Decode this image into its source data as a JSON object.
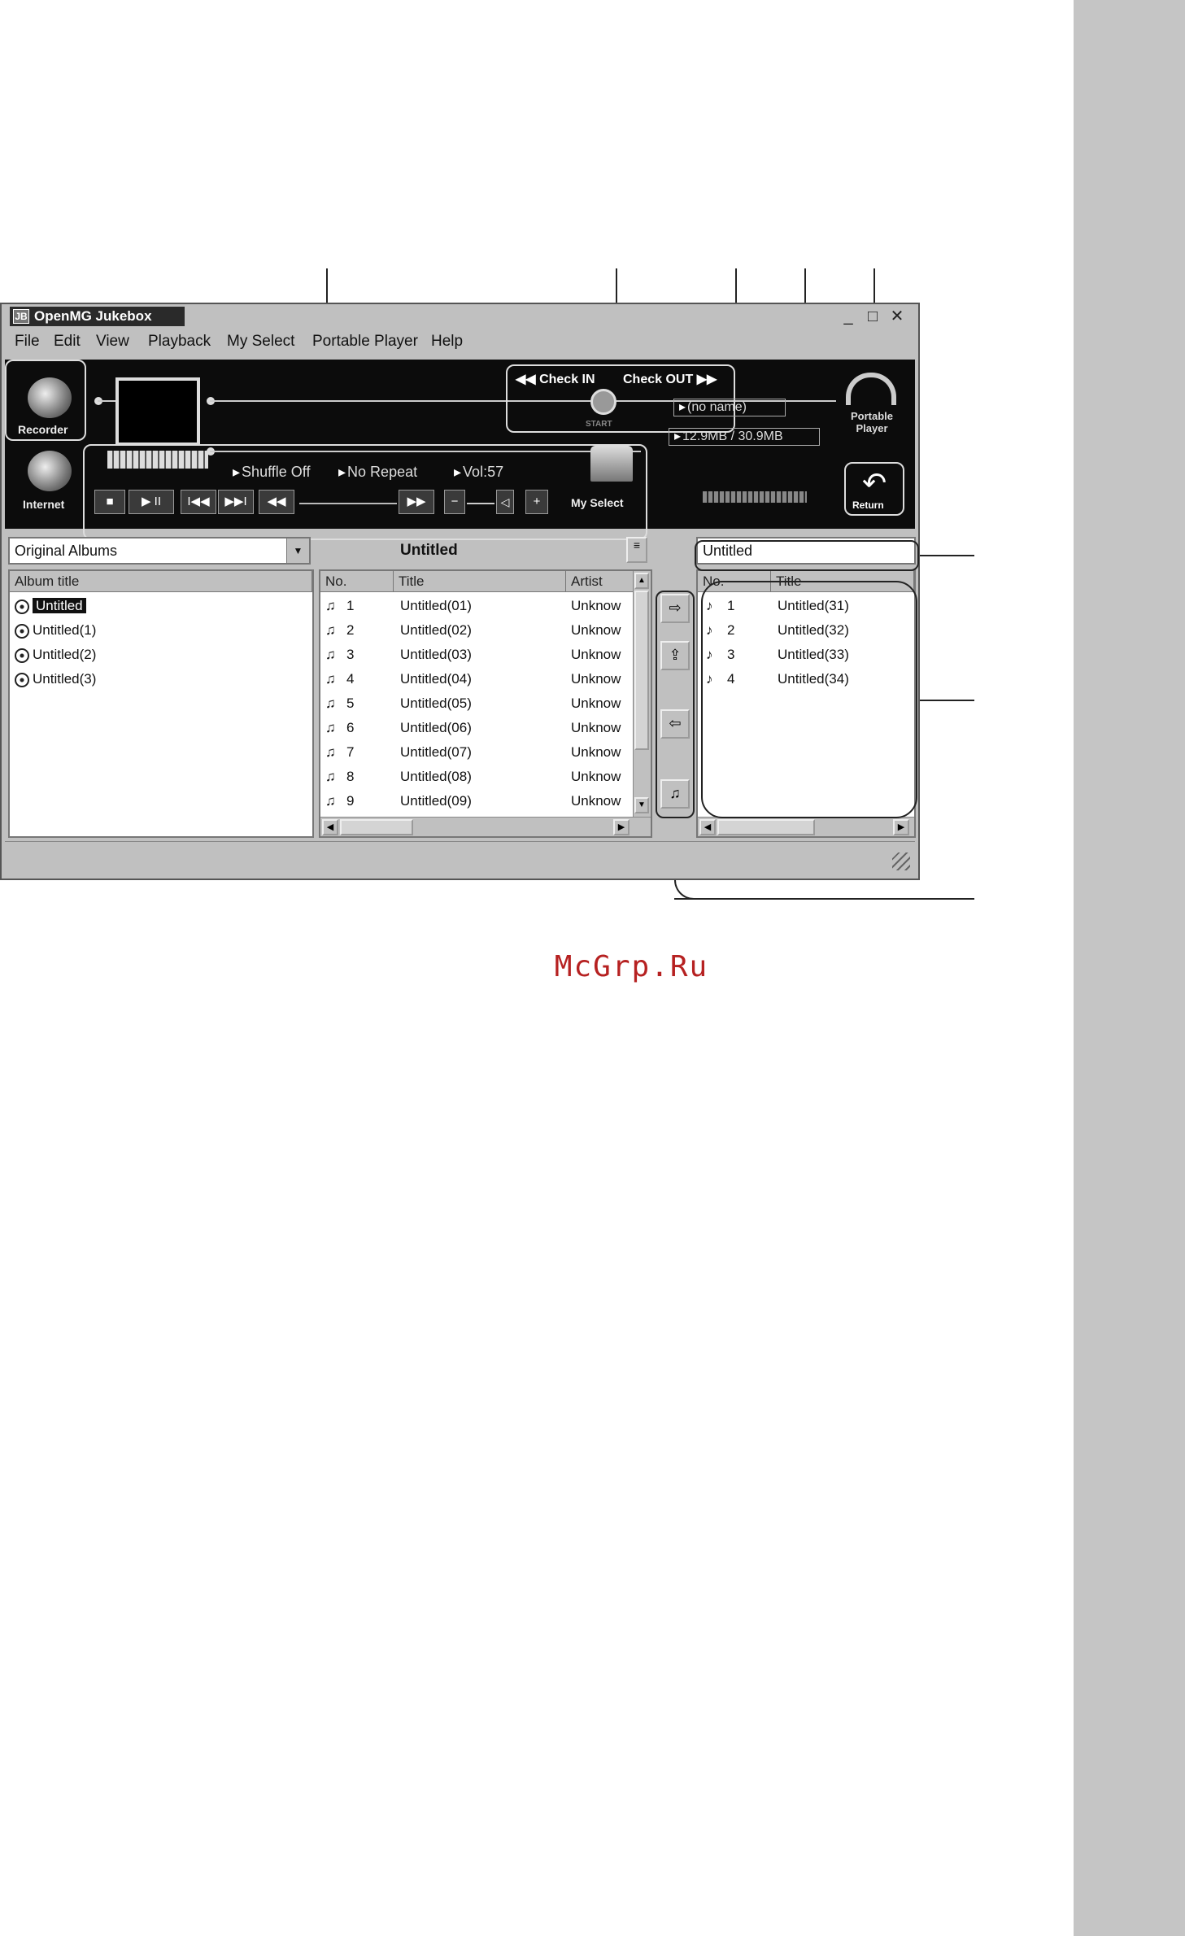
{
  "window": {
    "title": "OpenMG Jukebox",
    "icon_label": "JB",
    "controls": [
      "_",
      "□",
      "✕"
    ]
  },
  "menu": [
    "File",
    "Edit",
    "View",
    "Playback",
    "My Select",
    "Portable Player",
    "Help"
  ],
  "player": {
    "recorder_label": "Recorder",
    "internet_label": "Internet",
    "shuffle": "Shuffle Off",
    "repeat": "No Repeat",
    "volume": "Vol:57",
    "transport": [
      "■",
      "▶ II",
      "I◀◀",
      "▶▶I",
      "◀◀",
      "▶▶",
      "−",
      "+"
    ],
    "my_select_label": "My Select",
    "check_in": "Check IN",
    "check_out": "Check OUT",
    "start_label": "START",
    "device_name": "(no name)",
    "capacity": "12.9MB / 30.9MB",
    "portable_player_label": "Portable Player",
    "return_label": "Return"
  },
  "library": {
    "source_select": "Original Albums",
    "album_title": "Untitled",
    "album_column": "Album title",
    "albums": [
      {
        "label": "Untitled",
        "selected": true
      },
      {
        "label": "Untitled(1)",
        "selected": false
      },
      {
        "label": "Untitled(2)",
        "selected": false
      },
      {
        "label": "Untitled(3)",
        "selected": false
      }
    ],
    "track_columns": [
      "No.",
      "Title",
      "Artist"
    ],
    "tracks": [
      {
        "no": "1",
        "title": "Untitled(01)",
        "artist": "Unknow"
      },
      {
        "no": "2",
        "title": "Untitled(02)",
        "artist": "Unknow"
      },
      {
        "no": "3",
        "title": "Untitled(03)",
        "artist": "Unknow"
      },
      {
        "no": "4",
        "title": "Untitled(04)",
        "artist": "Unknow"
      },
      {
        "no": "5",
        "title": "Untitled(05)",
        "artist": "Unknow"
      },
      {
        "no": "6",
        "title": "Untitled(06)",
        "artist": "Unknow"
      },
      {
        "no": "7",
        "title": "Untitled(07)",
        "artist": "Unknow"
      },
      {
        "no": "8",
        "title": "Untitled(08)",
        "artist": "Unknow"
      },
      {
        "no": "9",
        "title": "Untitled(09)",
        "artist": "Unknow"
      }
    ]
  },
  "portable": {
    "name_field": "Untitled",
    "columns": [
      "No.",
      "Title"
    ],
    "tracks": [
      {
        "no": "1",
        "title": "Untitled(31)"
      },
      {
        "no": "2",
        "title": "Untitled(32)"
      },
      {
        "no": "3",
        "title": "Untitled(33)"
      },
      {
        "no": "4",
        "title": "Untitled(34)"
      }
    ]
  },
  "transfer_buttons": [
    "⇨",
    "⇪",
    "⇦",
    "♫"
  ],
  "watermark": "McGrp.Ru"
}
